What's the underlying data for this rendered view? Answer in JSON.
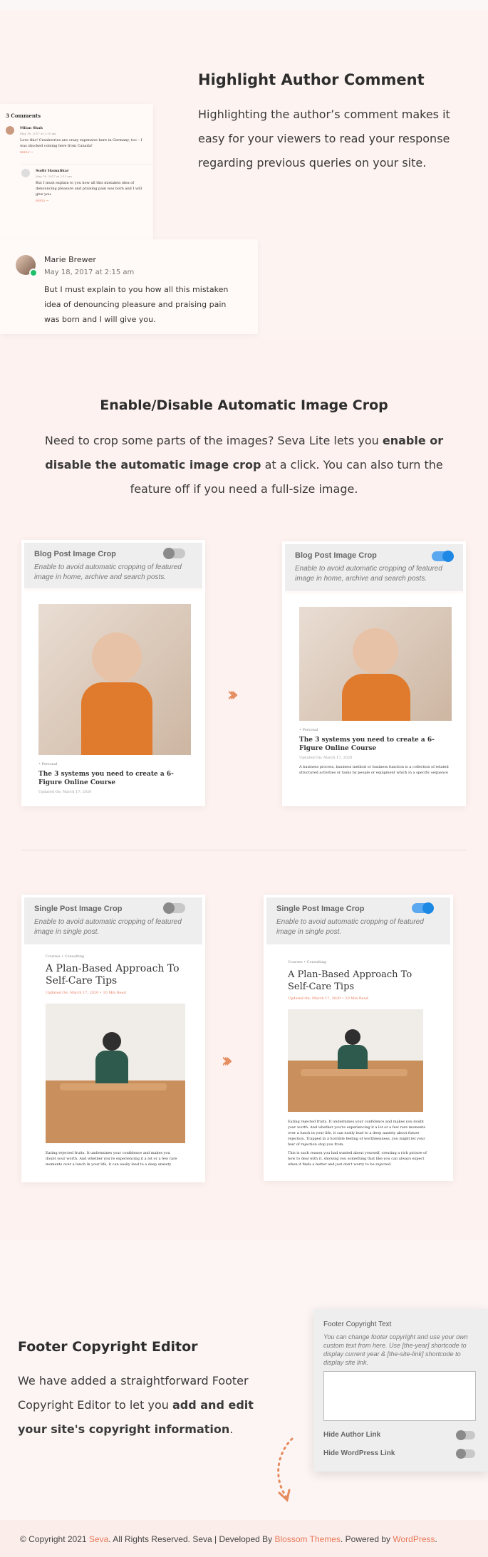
{
  "author": {
    "title": "Highlight Author Comment",
    "description": "Highlighting the author’s comment makes it easy for your viewers to read your response regarding previous queries on your site.",
    "comments_count": "3 Comments",
    "c1": {
      "name": "Milan Shah",
      "date": "May 18, 2017 at 2:15 am",
      "text": "Love this! Cranberries are crazy expensive here in Germany, too – I was shocked coming here from Canada!",
      "reply": "REPLY →"
    },
    "c2": {
      "name": "Sudir Hamal​ikar",
      "date": "May 18, 2017 at 2:15 am",
      "text": "But I must explain to you how all this mistaken idea of denouncing pleasure and praising pain was born and I will give you.",
      "reply": "REPLY →"
    },
    "c3": {
      "name": "Marie Brewer",
      "date": "May 18, 2017 at 2:15 am",
      "text": "But I must explain to you how all this mistaken idea of denouncing pleasure and praising pain was born and I will give you."
    }
  },
  "crop": {
    "title": "Enable/Disable Automatic Image Crop",
    "desc_a": "Need to crop some parts of the images? Seva Lite lets you ",
    "desc_b": "enable or disable the automatic image crop",
    "desc_c": " at a click. You can also turn the feature off if you need a full-size image.",
    "blog_label": "Blog Post Image Crop",
    "blog_desc": "Enable to avoid automatic cropping of featured image in home, archive and search posts.",
    "blog_cat": "• Personal",
    "blog_post_title": "The 3 systems you need to create a 6-Figure Online Course",
    "blog_meta": "Updated On: March 17, 2020",
    "blog_excerpt": "A business process, business method or business function is a collection of related structured activities or tasks by people or equipment which in a specific sequence produce.",
    "single_label": "Single Post Image Crop",
    "single_desc": "Enable to avoid automatic cropping of featured image in single post.",
    "single_cat": "Courses • Consulting",
    "single_post_title": "A Plan-Based Approach To Self-Care Tips",
    "single_meta": "Updated On: March 17, 2020 • 10 Min Read",
    "single_body": "Eating rejected fruits. It undermines your confidence and makes you doubt your worth. And whether you're experiencing it a lot or a few rare moments over a lunch in your life, it can easily lead to a deep anxiety about future rejection. Trapped in a horrible feeling of worthlessness, you might let your fear of rejection stop you from.",
    "single_body2": "This is such reason you had wanted about yourself, creating a rich picture of how to deal with it, showing you something that like you can always expect when it finds a better and just don't worry to be rejected.",
    "arrows": "›››"
  },
  "footer_editor": {
    "title": "Footer Copyright Editor",
    "desc_a": "We have added a straightforward Footer Copyright Editor to let you ",
    "desc_b": "add and edit your site's copyright information",
    "desc_c": ".",
    "panel_label": "Footer Copyright Text",
    "panel_desc": "You can change footer copyright and use your own custom text from here. Use [the-year] shortcode to display current year & [the-site-link] shortcode to display site link.",
    "hide_author": "Hide Author Link",
    "hide_wp": "Hide WordPress Link"
  },
  "footer": {
    "copy": "© Copyright 2021 ",
    "site": "Seva",
    "rights": ". All Rights Reserved. Seva | Developed By ",
    "dev": "Blossom Themes",
    "powered": ". Powered by ",
    "wp": "WordPress",
    "end": "."
  },
  "colors": {
    "accent": "#e8785a",
    "toggle_on": "#1e88e5",
    "background": "#fdf2ef"
  }
}
